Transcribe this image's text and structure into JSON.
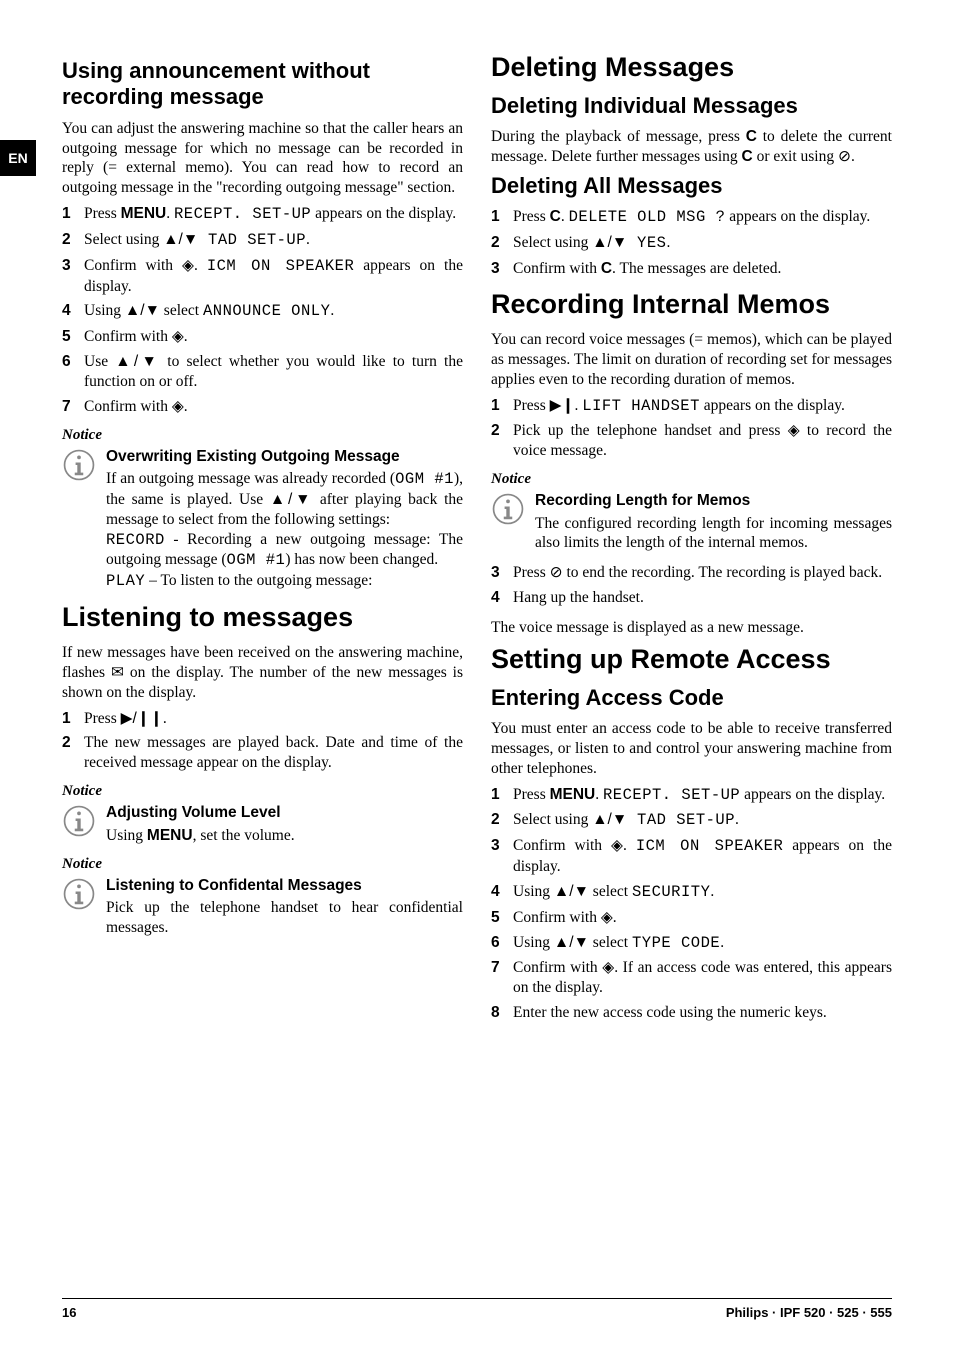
{
  "lang_tab": "EN",
  "footer": {
    "page_no": "16",
    "brand": "Philips · IPF 520 · 525 · 555"
  },
  "left": {
    "h2_announce": "Using announcement without recording message",
    "p_announce": "You can adjust the answering machine so that the caller hears an outgoing message for which no message can be recorded in reply (= external memo). You can read how to record an outgoing message in the \"recording outgoing message\" section.",
    "steps_ann": {
      "s1a": "Press ",
      "s1_menu": "MENU",
      "s1b": ". ",
      "s1_mono": "RECEPT. SET-UP",
      "s1c": " appears on the display.",
      "s2a": "Select using ",
      "s2_arrows": "▲/▼",
      "s2_mono": " TAD SET-UP",
      "s2b": ".",
      "s3a": "Confirm with ",
      "s3_sym": "◈",
      "s3b": ". ",
      "s3_mono": "ICM ON SPEAKER",
      "s3c": " appears on the display.",
      "s4a": "Using ",
      "s4_arrows": "▲/▼",
      "s4b": " select ",
      "s4_mono": "ANNOUNCE ONLY",
      "s4c": ".",
      "s5a": "Confirm with ",
      "s5_sym": "◈",
      "s5b": ".",
      "s6a": "Use ",
      "s6_arrows": "▲/▼",
      "s6b": " to select whether you would like to turn the function on or off.",
      "s7a": "Confirm with ",
      "s7_sym": "◈",
      "s7b": "."
    },
    "notice1_label": "Notice",
    "notice1_title": "Overwriting Existing Outgoing Message",
    "notice1_t1a": "If an outgoing message was already recorded (",
    "notice1_t1_mono": "OGM #1",
    "notice1_t1b": "), the same is played. Use ",
    "notice1_t1_arrows": "▲/▼",
    "notice1_t1c": " after playing back the message to select from the following settings:",
    "notice1_t2_mono": "RECORD",
    "notice1_t2a": " - Recording a new outgoing message: The outgoing message (",
    "notice1_t2_mono2": "OGM #1",
    "notice1_t2b": ") has now been changed.",
    "notice1_t3_mono": "PLAY",
    "notice1_t3a": " – To listen to the outgoing message:",
    "h1_listen": "Listening to messages",
    "p_listen_a": "If new messages have been received on the answering machine, flashes ",
    "p_listen_env": "✉",
    "p_listen_b": " on the display. The number of the new messages is shown on the display.",
    "steps_listen": {
      "s1a": "Press ",
      "s1_sym": "▶/❙❙",
      "s1b": ".",
      "s2": "The new messages are played back. Date and time of the received message appear on the display."
    },
    "notice2_label": "Notice",
    "notice2_title": "Adjusting Volume Level",
    "notice2_t_a": "Using ",
    "notice2_t_menu": "MENU",
    "notice2_t_b": ", set the volume.",
    "notice3_label": "Notice",
    "notice3_title": "Listening to Confidental Messages",
    "notice3_text": "Pick up the telephone handset to hear confidential messages.",
    "h1_delete": "Deleting Messages",
    "h2_del_ind": "Deleting Individual Messages",
    "p_delind_a": "During the playback of message, press ",
    "p_delind_c1": "C",
    "p_delind_b": " to delete the current message. Delete further messages using ",
    "p_delind_c2": "C",
    "p_delind_c": " or exit using ",
    "p_delind_sym": "⊘",
    "p_delind_d": ".",
    "h2_del_all": "Deleting All Messages",
    "steps_delall": {
      "s1a": "Press ",
      "s1_c": "C",
      "s1b": ". ",
      "s1_mono": "DELETE OLD MSG ?",
      "s1c": " appears on the display.",
      "s2a": "Select using ",
      "s2_arrows": "▲/▼",
      "s2_mono": " YES",
      "s2b": ".",
      "s3a": "Confirm with ",
      "s3_c": "C",
      "s3b": ". The messages are deleted."
    },
    "h1_memos": "Recording Internal Memos",
    "p_memos": "You can record voice messages (= memos), which can be played as messages. The limit on duration of recording set for messages applies even to the recording duration of memos.",
    "steps_memos12": {
      "s1a": "Press ",
      "s1_sym": "▶❙",
      "s1b": ". ",
      "s1_mono": "LIFT HANDSET",
      "s1c": " appears on the display.",
      "s2a": "Pick up the telephone handset and press ",
      "s2_sym": "◈",
      "s2b": " to record the voice message."
    },
    "notice4_label": "Notice",
    "notice4_title": "Recording Length for Memos",
    "notice4_text": "The configured recording length for incoming messages also limits the length of the internal memos.",
    "steps_memos34": {
      "s3a": "Press ",
      "s3_sym": "⊘",
      "s3b": " to end the recording. The recording is played back.",
      "s4": "Hang up the handset."
    },
    "p_memos_end": "The voice message is displayed as a new message.",
    "h1_remote": "Setting up Remote Access",
    "h2_code": "Entering Access Code",
    "p_code": "You must enter an access code to be able to receive transferred messages, or listen to and control your answering machine from other telephones.",
    "steps_code": {
      "s1a": "Press ",
      "s1_menu": "MENU",
      "s1b": ". ",
      "s1_mono": "RECEPT. SET-UP",
      "s1c": " appears on the display.",
      "s2a": "Select using ",
      "s2_arrows": "▲/▼",
      "s2_mono": " TAD SET-UP",
      "s2b": ".",
      "s3a": "Confirm with ",
      "s3_sym": "◈",
      "s3b": ". ",
      "s3_mono": "ICM ON SPEAKER",
      "s3c": " appears on the display.",
      "s4a": "Using ",
      "s4_arrows": "▲/▼",
      "s4b": " select ",
      "s4_mono": "SECURITY",
      "s4c": ".",
      "s5a": "Confirm with ",
      "s5_sym": "◈",
      "s5b": ".",
      "s6a": "Using ",
      "s6_arrows": "▲/▼",
      "s6b": " select ",
      "s6_mono": "TYPE CODE",
      "s6c": ".",
      "s7a": "Confirm with ",
      "s7_sym": "◈",
      "s7b": ". If an access code was entered, this appears on the display.",
      "s8": "Enter the new access code using the numeric keys."
    }
  }
}
